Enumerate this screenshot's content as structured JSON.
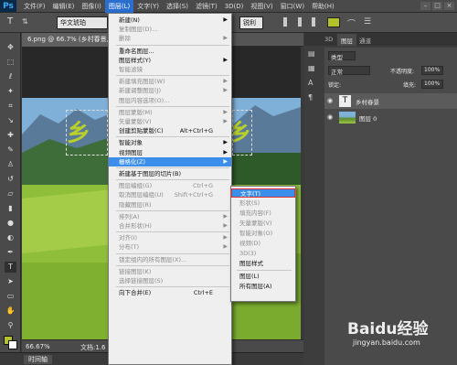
{
  "menubar": {
    "logo": "Ps",
    "items": [
      "文件(F)",
      "编辑(E)",
      "图像(I)",
      "图层(L)",
      "文字(Y)",
      "选择(S)",
      "滤镜(T)",
      "3D(D)",
      "视图(V)",
      "窗口(W)",
      "帮助(H)"
    ],
    "active_index": 3
  },
  "options": {
    "font_name": "华文琥珀",
    "antialias": "锐利",
    "color_swatch": "#b3c12a"
  },
  "document": {
    "tab_title": "6.png @ 66.7% (乡村春景, RG",
    "zoom": "66.67%",
    "doc_info": "文档:1.6",
    "timeline": "时间轴"
  },
  "artwork_text": "乡村春景",
  "layer_menu": {
    "items": [
      {
        "label": "新建(N)",
        "arrow": true
      },
      {
        "label": "复制图层(D)...",
        "disabled": true
      },
      {
        "label": "删除",
        "arrow": true,
        "disabled": true
      },
      {
        "sep": true
      },
      {
        "label": "重命名图层..."
      },
      {
        "label": "图层样式(Y)",
        "arrow": true
      },
      {
        "label": "智能滤镜",
        "disabled": true
      },
      {
        "sep": true
      },
      {
        "label": "新建填充图层(W)",
        "arrow": true,
        "disabled": true
      },
      {
        "label": "新建调整图层(J)",
        "arrow": true,
        "disabled": true
      },
      {
        "label": "图层内容选项(O)...",
        "disabled": true
      },
      {
        "sep": true
      },
      {
        "label": "图层蒙版(M)",
        "arrow": true,
        "disabled": true
      },
      {
        "label": "矢量蒙版(V)",
        "arrow": true,
        "disabled": true
      },
      {
        "label": "创建剪贴蒙版(C)",
        "shortcut": "Alt+Ctrl+G"
      },
      {
        "sep": true
      },
      {
        "label": "智能对象",
        "arrow": true
      },
      {
        "label": "视频图层",
        "arrow": true
      },
      {
        "label": "栅格化(Z)",
        "arrow": true,
        "selected": true
      },
      {
        "sep": true
      },
      {
        "label": "新建基于图层的切片(B)"
      },
      {
        "sep": true
      },
      {
        "label": "图层编组(G)",
        "shortcut": "Ctrl+G",
        "disabled": true
      },
      {
        "label": "取消图层编组(U)",
        "shortcut": "Shift+Ctrl+G",
        "disabled": true
      },
      {
        "label": "隐藏图层(R)",
        "disabled": true
      },
      {
        "sep": true
      },
      {
        "label": "排列(A)",
        "arrow": true,
        "disabled": true
      },
      {
        "label": "合并形状(H)",
        "arrow": true,
        "disabled": true
      },
      {
        "sep": true
      },
      {
        "label": "对齐(I)",
        "arrow": true,
        "disabled": true
      },
      {
        "label": "分布(T)",
        "arrow": true,
        "disabled": true
      },
      {
        "sep": true
      },
      {
        "label": "锁定组内的所有图层(X)...",
        "disabled": true
      },
      {
        "sep": true
      },
      {
        "label": "链接图层(K)",
        "disabled": true
      },
      {
        "label": "选择链接图层(S)",
        "disabled": true
      },
      {
        "sep": true
      },
      {
        "label": "向下合并(E)",
        "shortcut": "Ctrl+E"
      }
    ]
  },
  "rasterize_submenu": {
    "items": [
      {
        "label": "文字(T)",
        "selected": true
      },
      {
        "label": "形状(S)",
        "disabled": true
      },
      {
        "label": "填充内容(F)",
        "disabled": true
      },
      {
        "label": "矢量蒙版(V)",
        "disabled": true
      },
      {
        "label": "智能对象(O)",
        "disabled": true
      },
      {
        "label": "视频(D)",
        "disabled": true
      },
      {
        "label": "3D(3)",
        "disabled": true
      },
      {
        "label": "图层样式"
      },
      {
        "sep": true
      },
      {
        "label": "图层(L)"
      },
      {
        "label": "所有图层(A)"
      }
    ]
  },
  "right_panel": {
    "tabs": [
      "3D",
      "图层",
      "通道"
    ],
    "filter_label": "类型",
    "blend_mode": "正常",
    "opacity_label": "不透明度:",
    "opacity_value": "100%",
    "lock_label": "锁定:",
    "fill_label": "填充:",
    "fill_value": "100%",
    "layers": [
      {
        "name": "乡村春景",
        "type": "text"
      },
      {
        "name": "图层 0",
        "type": "image"
      }
    ]
  },
  "watermark": {
    "brand": "Baidu经验",
    "url": "jingyan.baidu.com"
  }
}
